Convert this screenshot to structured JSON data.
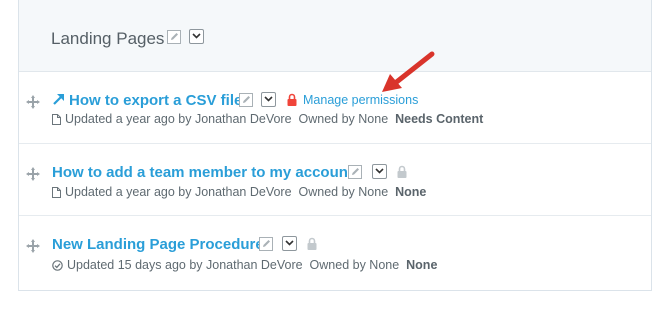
{
  "section": {
    "title": "Landing Pages"
  },
  "pages": [
    {
      "title": "How to export a CSV file",
      "meta_updated": "Updated a year ago by Jonathan DeVore",
      "meta_owner": "Owned by None",
      "meta_status": "Needs Content",
      "manage_permissions": "Manage permissions",
      "lock_state": "locked-red",
      "type_icon": "document-icon"
    },
    {
      "title": "How to add a team member to my account",
      "meta_updated": "Updated a year ago by Jonathan DeVore",
      "meta_owner": "Owned by None",
      "meta_status": "None",
      "lock_state": "locked-grey",
      "type_icon": "document-icon"
    },
    {
      "title": "New Landing Page Procedure",
      "meta_updated": "Updated 15 days ago by Jonathan DeVore",
      "meta_owner": "Owned by None",
      "meta_status": "None",
      "lock_state": "locked-grey",
      "type_icon": "checklist-icon"
    }
  ],
  "colors": {
    "link": "#2a9ed8",
    "lock_active": "#f0443a",
    "annotation_arrow": "#d9342b"
  }
}
